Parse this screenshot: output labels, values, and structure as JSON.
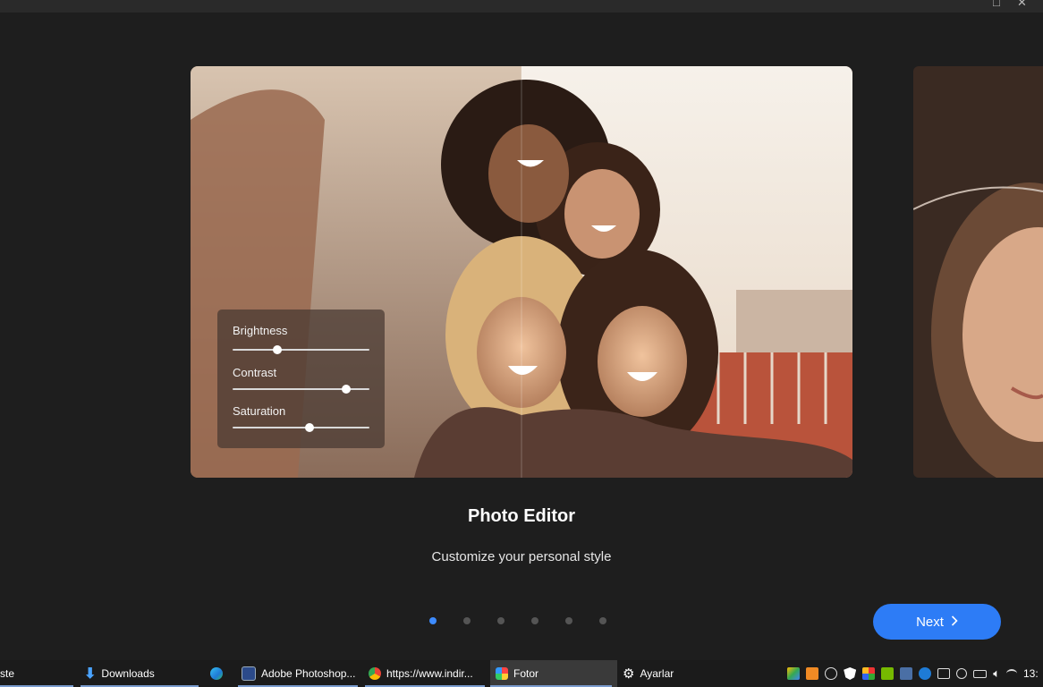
{
  "window": {
    "maximize_glyph": "□",
    "close_glyph": "✕"
  },
  "slide": {
    "title": "Photo Editor",
    "subtitle": "Customize your personal style"
  },
  "adjust_panel": {
    "sliders": [
      {
        "label": "Brightness",
        "value": 0.33
      },
      {
        "label": "Contrast",
        "value": 0.83
      },
      {
        "label": "Saturation",
        "value": 0.56
      }
    ]
  },
  "pagination": {
    "count": 6,
    "active_index": 0
  },
  "next_button": {
    "label": "Next",
    "icon": "chevron-right-icon"
  },
  "taskbar": {
    "items": [
      {
        "label": "ste",
        "icon": "none"
      },
      {
        "label": "Downloads",
        "icon": "download-arrow-icon"
      },
      {
        "label": "",
        "icon": "edge-icon"
      },
      {
        "label": "Adobe Photoshop...",
        "icon": "photoshop-installer-icon"
      },
      {
        "label": "https://www.indir...",
        "icon": "chrome-icon"
      },
      {
        "label": "Fotor",
        "icon": "fotor-icon",
        "active": true
      },
      {
        "label": "Ayarlar",
        "icon": "gear-icon"
      }
    ],
    "clock": "13:"
  },
  "colors": {
    "accent": "#2d7cf6",
    "dot_active": "#3d8bff",
    "dot_inactive": "#555555",
    "background": "#1e1e1e"
  }
}
